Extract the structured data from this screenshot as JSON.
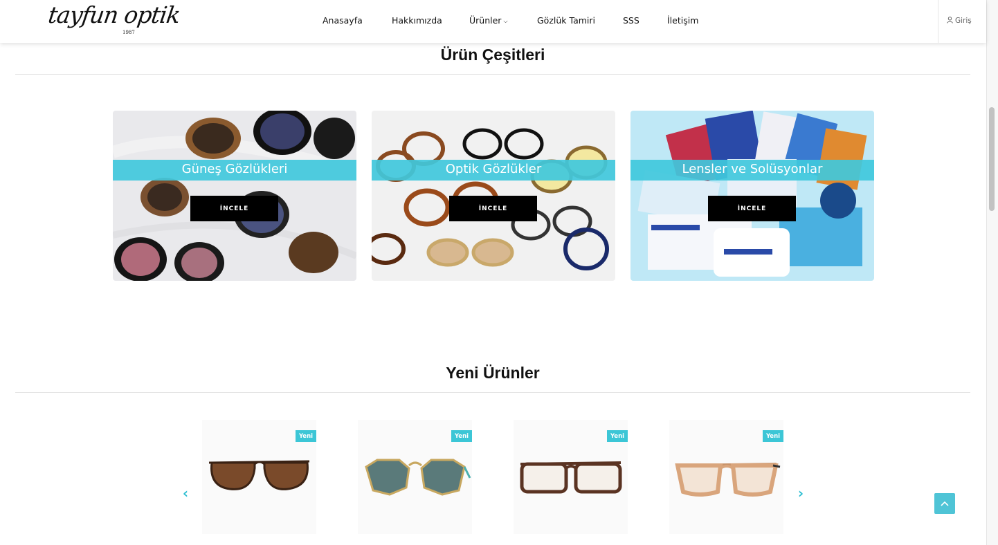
{
  "brand": {
    "logo_text": "tayfun optik",
    "logo_year": "1987"
  },
  "nav": {
    "items": [
      {
        "label": "Anasayfa"
      },
      {
        "label": "Hakkımızda"
      },
      {
        "label": "Ürünler"
      },
      {
        "label": "Gözlük Tamiri"
      },
      {
        "label": "SSS"
      },
      {
        "label": "İletişim"
      }
    ],
    "login_label": "Giriş"
  },
  "categories_section": {
    "title": "Ürün Çeşitleri",
    "cards": [
      {
        "title": "Güneş Gözlükleri",
        "button": "İNCELE"
      },
      {
        "title": "Optik Gözlükler",
        "button": "İNCELE"
      },
      {
        "title": "Lensler ve Solüsyonlar",
        "button": "İNCELE"
      }
    ]
  },
  "new_products_section": {
    "title": "Yeni Ürünler",
    "products": [
      {
        "badge": "Yeni",
        "frame_color": "#4a2a1c",
        "lens_color": "#7a4a2a"
      },
      {
        "badge": "Yeni",
        "frame_color": "#c8a860",
        "lens_color": "#5a7a7a"
      },
      {
        "badge": "Yeni",
        "frame_color": "#5a3322",
        "lens_color": "#f5f0ea"
      },
      {
        "badge": "Yeni",
        "frame_color": "#d9a57c",
        "lens_color": "#f3e4d6"
      }
    ]
  },
  "colors": {
    "accent": "#40c8dc",
    "button": "#000000"
  }
}
